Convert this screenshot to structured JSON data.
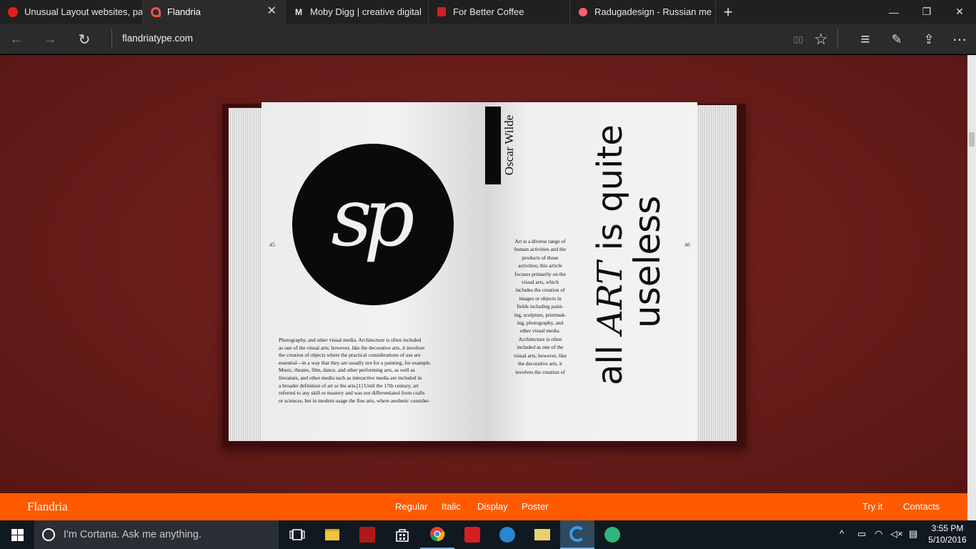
{
  "browser": {
    "tabs": [
      {
        "title": "Unusual Layout websites, pa",
        "favicon": "red-circle-icon",
        "active": false
      },
      {
        "title": "Flandria",
        "favicon": "flandria-logo-icon",
        "active": true
      },
      {
        "title": "Moby Digg | creative digital",
        "favicon": "M",
        "active": false
      },
      {
        "title": "For Better Coffee",
        "favicon": "coffee-icon",
        "active": false
      },
      {
        "title": "Radugadesign - Russian me",
        "favicon": "pink-circle-icon",
        "active": false
      }
    ],
    "tab_close_glyph": "✕",
    "new_tab_glyph": "+",
    "url": "flandriatype.com",
    "window_controls": {
      "minimize": "—",
      "restore": "❐",
      "close": "✕"
    },
    "nav": {
      "back": "←",
      "forward": "→",
      "refresh": "↻"
    },
    "toolbar": {
      "reading_view": "▯▯",
      "favorite": "☆",
      "hub": "≡",
      "web_note": "✎",
      "share": "⇪",
      "more": "⋯"
    }
  },
  "book": {
    "logo_text": "sp",
    "page_left_number": "45",
    "page_right_number": "46",
    "left_paragraph_lines": [
      "Photography, and other visual media. Architecture is often included",
      "as one of the visual arts; however, like the decorative arts, it involves",
      "the creation of objects where the practical considerations of use are",
      "essential—in a way that they are usually not for a painting, for example.",
      "Music, theatre, film, dance, and other performing arts, as well as",
      "literature, and other media such as interactive media are included in",
      "a broader definition of art or the arts.[1] Until the 17th century, art",
      "referred to any skill or mastery and was not differentiated from crafts",
      "or sciences, but in modern usage the fine arts, where aesthetic consider-"
    ],
    "author": "Oscar Wilde",
    "middle_paragraph_lines": [
      "Art is a diverse range of",
      "human activities and the",
      "products of those",
      "activities; this article",
      "focuses primarily on the",
      "visual arts, which",
      "includes the creation of",
      "images or objects in",
      "fields including paint-",
      "ing, sculpture, printmak-",
      "ing, photography, and",
      "other visual media.",
      "Architecture is often",
      "included as one of the",
      "visual arts; however, like",
      "the decorative arts, it",
      "involves the creation of"
    ],
    "quote": {
      "part1": "all ",
      "emphasis": "ART",
      "part2": " is quite",
      "line2": "useless"
    }
  },
  "site_nav": {
    "brand": "Flandria",
    "links": [
      "Regular",
      "Italic",
      "Display",
      "Poster"
    ],
    "right_links": [
      "Try it",
      "Contacts"
    ],
    "accent_color": "#ff5a00"
  },
  "taskbar": {
    "search_placeholder": "I'm Cortana. Ask me anything.",
    "time": "3:55 PM",
    "date": "5/10/2016",
    "apps": [
      "task-view-icon",
      "file-explorer-icon",
      "app-red-icon",
      "store-icon",
      "chrome-icon",
      "creative-cloud-icon",
      "app-blue-icon",
      "app-folder-icon",
      "edge-icon",
      "app-atom-icon"
    ]
  }
}
